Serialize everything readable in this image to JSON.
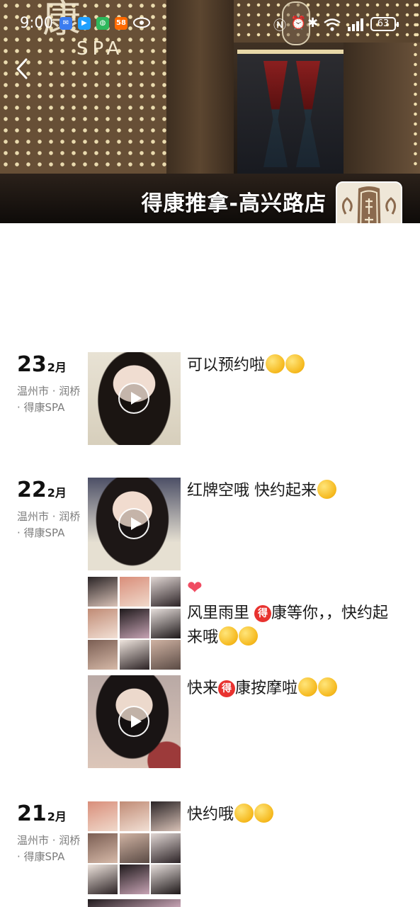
{
  "status_bar": {
    "time": "9:00",
    "battery": "63",
    "apps": [
      "mail-icon",
      "maps-icon",
      "wechat-icon",
      "58-icon",
      "eye-icon"
    ],
    "app_58_label": "58"
  },
  "cover": {
    "sign_char": "康",
    "sign_spa": "SPA"
  },
  "profile": {
    "name": "得康推拿-高兴路店"
  },
  "posts": [
    {
      "day": "23",
      "month": "2月",
      "location": "温州市 · 润桥 · 得康SPA",
      "media": "video",
      "text": "可以预约啦"
    },
    {
      "day": "22",
      "month": "2月",
      "location": "温州市 · 润桥 · 得康SPA",
      "media": "video",
      "text": "红牌空哦 快约起来"
    },
    {
      "media": "grid",
      "text_a": "风里雨里 ",
      "badge": "得",
      "text_b": "康等你，，快约起来哦"
    },
    {
      "media": "video",
      "text_a": "快来",
      "badge": "得",
      "text_b": "康按摩啦"
    },
    {
      "day": "21",
      "month": "2月",
      "location": "温州市 · 润桥 · 得康SPA",
      "media": "grid",
      "text": "快约哦"
    }
  ],
  "colors": {
    "accent_red": "#e8322f",
    "location_gray": "#7d7d7d",
    "heart": "#f04c62"
  }
}
